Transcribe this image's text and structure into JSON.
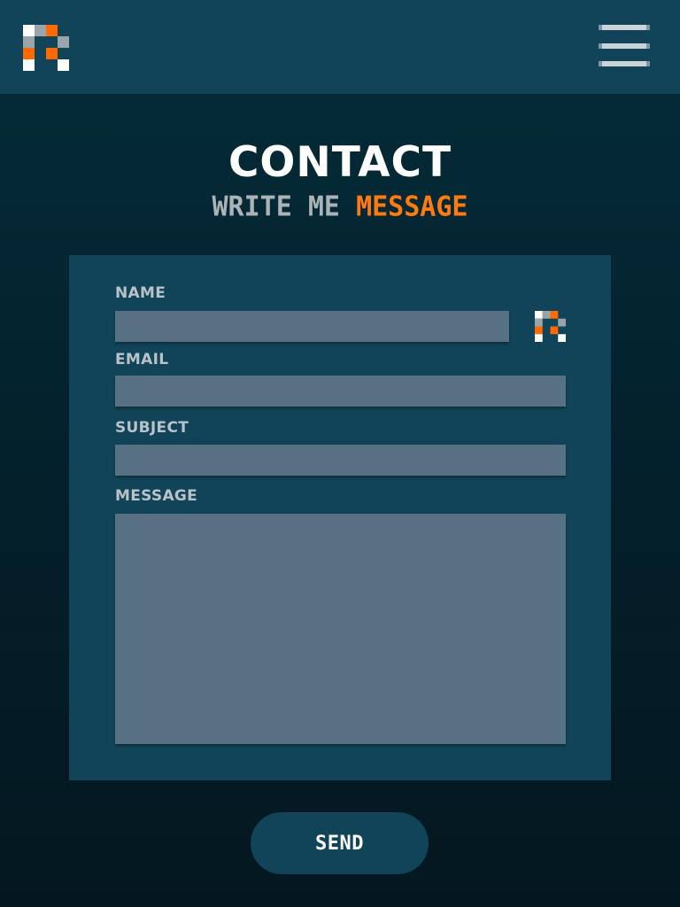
{
  "header": {
    "logo_icon": "pixel-r-logo",
    "menu_icon": "hamburger-menu-icon"
  },
  "heading": {
    "title": "CONTACT",
    "subtitle_part1": "WRITE ME",
    "subtitle_part2": "MESSAGE"
  },
  "form": {
    "name_label": "NAME",
    "name_value": "",
    "email_label": "EMAIL",
    "email_value": "",
    "subject_label": "SUBJECT",
    "subject_value": "",
    "message_label": "MESSAGE",
    "message_value": "",
    "send_label": "SEND"
  },
  "colors": {
    "header_bg": "#114458",
    "card_bg": "#114458",
    "field_bg": "#577183",
    "accent": "#ff7b12",
    "muted_text": "#aab3b8",
    "label_text": "#b8c2c9"
  }
}
